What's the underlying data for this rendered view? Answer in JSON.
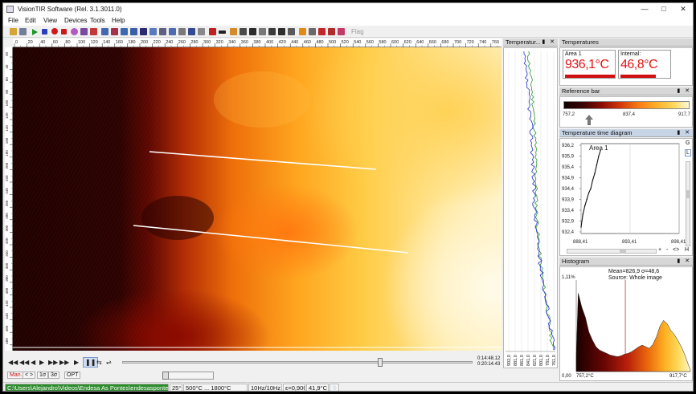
{
  "window": {
    "title": "VisionTIR Software (Rel. 3.1.3011.0)"
  },
  "menu": [
    "File",
    "Edit",
    "View",
    "Devices",
    "Tools",
    "Help"
  ],
  "toolbar": {
    "flag_label": "Flag"
  },
  "ruler_h_labels": [
    "0",
    "20",
    "40",
    "60",
    "80",
    "100",
    "120",
    "140",
    "160",
    "180",
    "200",
    "220",
    "240",
    "260",
    "280",
    "300",
    "320",
    "340",
    "360",
    "380",
    "400",
    "420",
    "440",
    "460",
    "480",
    "500",
    "520",
    "540",
    "560",
    "580",
    "600",
    "620",
    "640",
    "660",
    "680",
    "700",
    "720",
    "740",
    "760"
  ],
  "ruler_v_labels": [
    "20",
    "40",
    "60",
    "80",
    "100",
    "120",
    "140",
    "160",
    "180",
    "200",
    "220",
    "240",
    "260",
    "280",
    "300",
    "320",
    "340",
    "360",
    "380",
    "400",
    "420",
    "440",
    "460",
    "480",
    "500"
  ],
  "player": {
    "time_current": "0:14:48.12",
    "time_total": "0:20:14.43"
  },
  "mode_buttons": [
    "Man.",
    "< >",
    "1σ",
    "3σ",
    "OPT"
  ],
  "statusbar": {
    "path": "C:\\Users\\Alejandro\\Videos\\Endesa As Pontes\\endesaspontes3.ravi",
    "fov": "25°",
    "range": "500°C ... 1800°C",
    "rate": "10Hz/10Hz",
    "emissivity": "ε=0,900",
    "ambient": "41,9°C"
  },
  "profile_panel": {
    "title": "Temperatur...",
    "axis_labels": [
      "902,0",
      "881,0",
      "861,0",
      "841,0",
      "821,0",
      "801,0",
      "781,0",
      "761,0"
    ]
  },
  "temperatures_panel": {
    "title": "Temperatures",
    "area_label": "Area 1",
    "area_value": "936,1°C",
    "internal_label": "Internal:",
    "internal_value": "46,8°C"
  },
  "reference_bar": {
    "title": "Reference bar",
    "min": "757,2",
    "mid": "837,4",
    "max": "917,7"
  },
  "time_diagram": {
    "title": "Temperature time diagram",
    "series_label": "Area 1",
    "y_ticks": [
      "936,2",
      "935,9",
      "935,4",
      "934,9",
      "934,4",
      "933,9",
      "933,4",
      "932,9",
      "932,4"
    ],
    "x_ticks": [
      "888,41",
      "893,41",
      "898,41"
    ],
    "side_buttons": [
      "G",
      "L"
    ],
    "nav_buttons": [
      "+",
      "-",
      "<>",
      "H"
    ]
  },
  "histogram": {
    "title": "Histogram",
    "stats": "Mean=826,9 σ=48,6",
    "source": "Source:  Whole image",
    "y_top": "1,11%",
    "y_bottom": "0,00",
    "x_min": "757,2°C",
    "x_max": "917,7°C"
  },
  "chart_data": [
    {
      "type": "line",
      "title": "",
      "series": [
        {
          "name": "Area 1",
          "x": [
            888.41,
            888.6,
            888.8,
            889.0,
            889.2,
            889.4,
            889.6,
            889.8,
            890.0,
            890.2,
            890.4
          ],
          "values": [
            932.3,
            932.9,
            933.3,
            933.6,
            933.9,
            934.1,
            934.5,
            934.8,
            935.2,
            935.6,
            935.9
          ]
        }
      ],
      "x_ticks": [
        888.41,
        893.41,
        898.41
      ],
      "xlim": [
        888.41,
        898.41
      ],
      "ylim": [
        932.0,
        936.2
      ]
    },
    {
      "type": "area",
      "title": "Histogram",
      "xlim": [
        757.2,
        917.7
      ],
      "ylim": [
        0.0,
        1.11
      ],
      "x": [
        757.2,
        760,
        765,
        770,
        775,
        780,
        785,
        790,
        795,
        800,
        805,
        810,
        815,
        820,
        825,
        830,
        835,
        840,
        845,
        850,
        855,
        860,
        865,
        870,
        875,
        880,
        885,
        890,
        895,
        900,
        905,
        910,
        915,
        917.7
      ],
      "values": [
        0.2,
        0.95,
        0.78,
        0.66,
        0.48,
        0.38,
        0.3,
        0.26,
        0.24,
        0.22,
        0.2,
        0.19,
        0.18,
        0.19,
        0.21,
        0.22,
        0.24,
        0.27,
        0.3,
        0.32,
        0.3,
        0.28,
        0.33,
        0.42,
        0.55,
        0.62,
        0.58,
        0.5,
        0.45,
        0.38,
        0.3,
        0.2,
        0.08,
        0.02
      ]
    }
  ]
}
